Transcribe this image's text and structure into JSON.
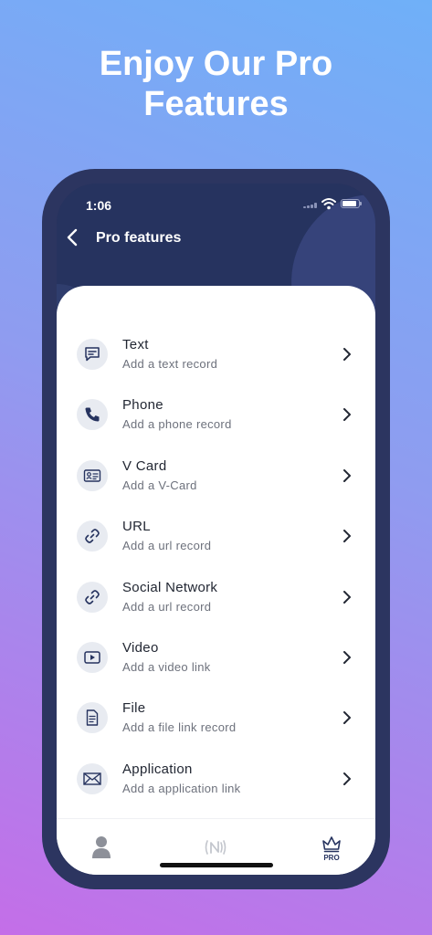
{
  "headline": {
    "line1": "Enjoy Our Pro",
    "line2": "Features"
  },
  "status_bar": {
    "time": "1:06"
  },
  "nav": {
    "title": "Pro features"
  },
  "features": [
    {
      "title": "Text",
      "subtitle": "Add a text record",
      "icon": "message-icon"
    },
    {
      "title": "Phone",
      "subtitle": "Add a phone record",
      "icon": "phone-icon"
    },
    {
      "title": "V Card",
      "subtitle": "Add a V-Card",
      "icon": "id-card-icon"
    },
    {
      "title": "URL",
      "subtitle": "Add a url record",
      "icon": "link-icon"
    },
    {
      "title": "Social Network",
      "subtitle": "Add a url record",
      "icon": "link-icon"
    },
    {
      "title": "Video",
      "subtitle": "Add a video link",
      "icon": "video-play-icon"
    },
    {
      "title": "File",
      "subtitle": "Add a file link record",
      "icon": "document-icon"
    },
    {
      "title": "Application",
      "subtitle": "Add a application link",
      "icon": "envelope-icon"
    }
  ],
  "tab_bar": {
    "tabs": [
      {
        "icon": "user-icon"
      },
      {
        "icon": "nfc-icon"
      },
      {
        "icon": "crown-icon",
        "label": "PRO"
      }
    ]
  },
  "colors": {
    "primary": "#26335f",
    "icon_bg": "#e8ebf1",
    "title_text": "#222733",
    "subtitle_text": "#6d717c"
  }
}
